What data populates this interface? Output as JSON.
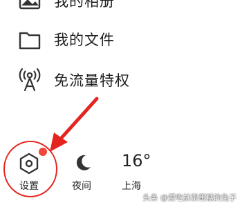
{
  "menu": {
    "items": [
      {
        "label": "我的相册",
        "icon": "photo-album-icon"
      },
      {
        "label": "我的文件",
        "icon": "folder-icon"
      },
      {
        "label": "免流量特权",
        "icon": "signal-tower-icon"
      }
    ]
  },
  "bottom_bar": {
    "settings": {
      "label": "设置",
      "icon": "settings-hexagon-icon",
      "badge_color": "#f0463c"
    },
    "night_mode": {
      "label": "夜间",
      "icon": "moon-icon"
    },
    "weather": {
      "temperature": "16°",
      "city": "上海"
    }
  },
  "annotation": {
    "color": "#e52420"
  },
  "watermark": {
    "text": "头条 @爱吃抹茶蛋糕的兔子"
  }
}
